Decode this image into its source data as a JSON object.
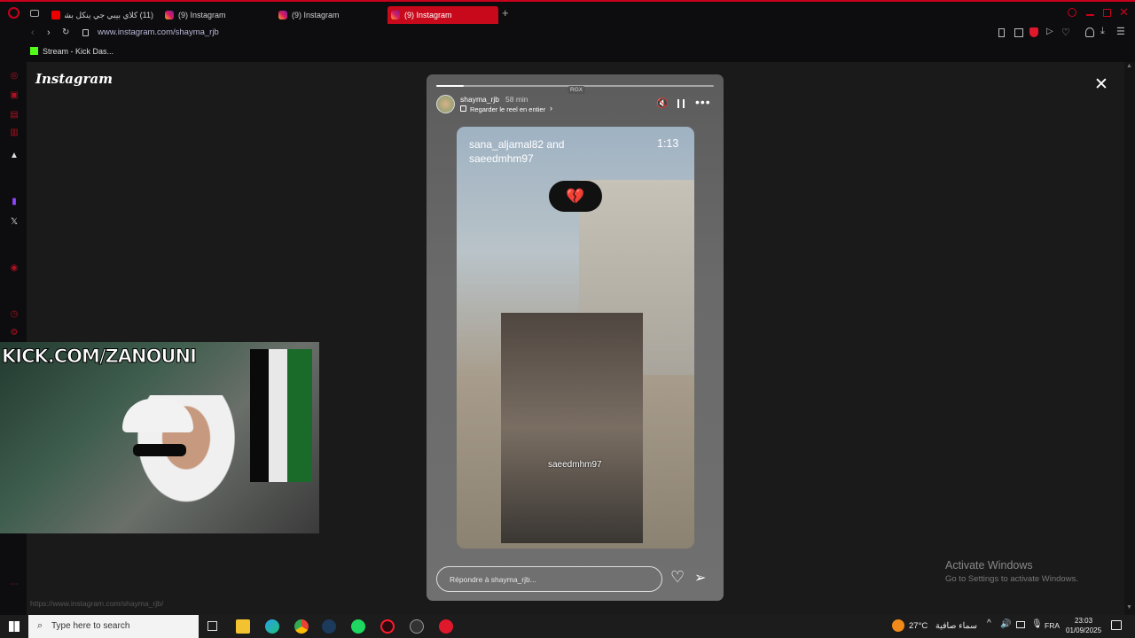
{
  "browser": {
    "tabs": [
      {
        "label": "(11) كلاي بيبي جي ينكل بشرف",
        "icon": "youtube-icon"
      },
      {
        "label": "(9) Instagram",
        "icon": "instagram-icon"
      },
      {
        "label": "(9) Instagram",
        "icon": "instagram-icon"
      },
      {
        "label": "(9) Instagram",
        "icon": "instagram-icon",
        "active": true
      }
    ],
    "url": "www.instagram.com/shayma_rjb",
    "bookmark": "Stream - Kick Das...",
    "status_url": "https://www.instagram.com/shayma_rjb/"
  },
  "instagram": {
    "logo": "Instagram",
    "story": {
      "progress": 0.1,
      "username": "shayma_rjb",
      "time": "58 min",
      "rgx": "RGX",
      "watch_reel": "Regarder le reel en entier",
      "inner_users": "sana_aljamal82 and\nsaeedmhm97",
      "duration": "1:13",
      "sticker": "💔",
      "mention": "saeedmhm97",
      "reply_placeholder": "Répondre à shayma_rjb..."
    }
  },
  "webcam": {
    "overlay": "KICK.COM/ZANOUNI"
  },
  "windows": {
    "activate_title": "Activate Windows",
    "activate_sub": "Go to Settings to activate Windows."
  },
  "taskbar": {
    "search_placeholder": "Type here to search",
    "weather_temp": "27°C",
    "weather_desc": "سماء صافية",
    "language": "FRA",
    "time": "23:03",
    "date": "01/09/2025"
  },
  "colors": {
    "accent": "#c8091c",
    "opera_red": "#ff1b2d"
  }
}
